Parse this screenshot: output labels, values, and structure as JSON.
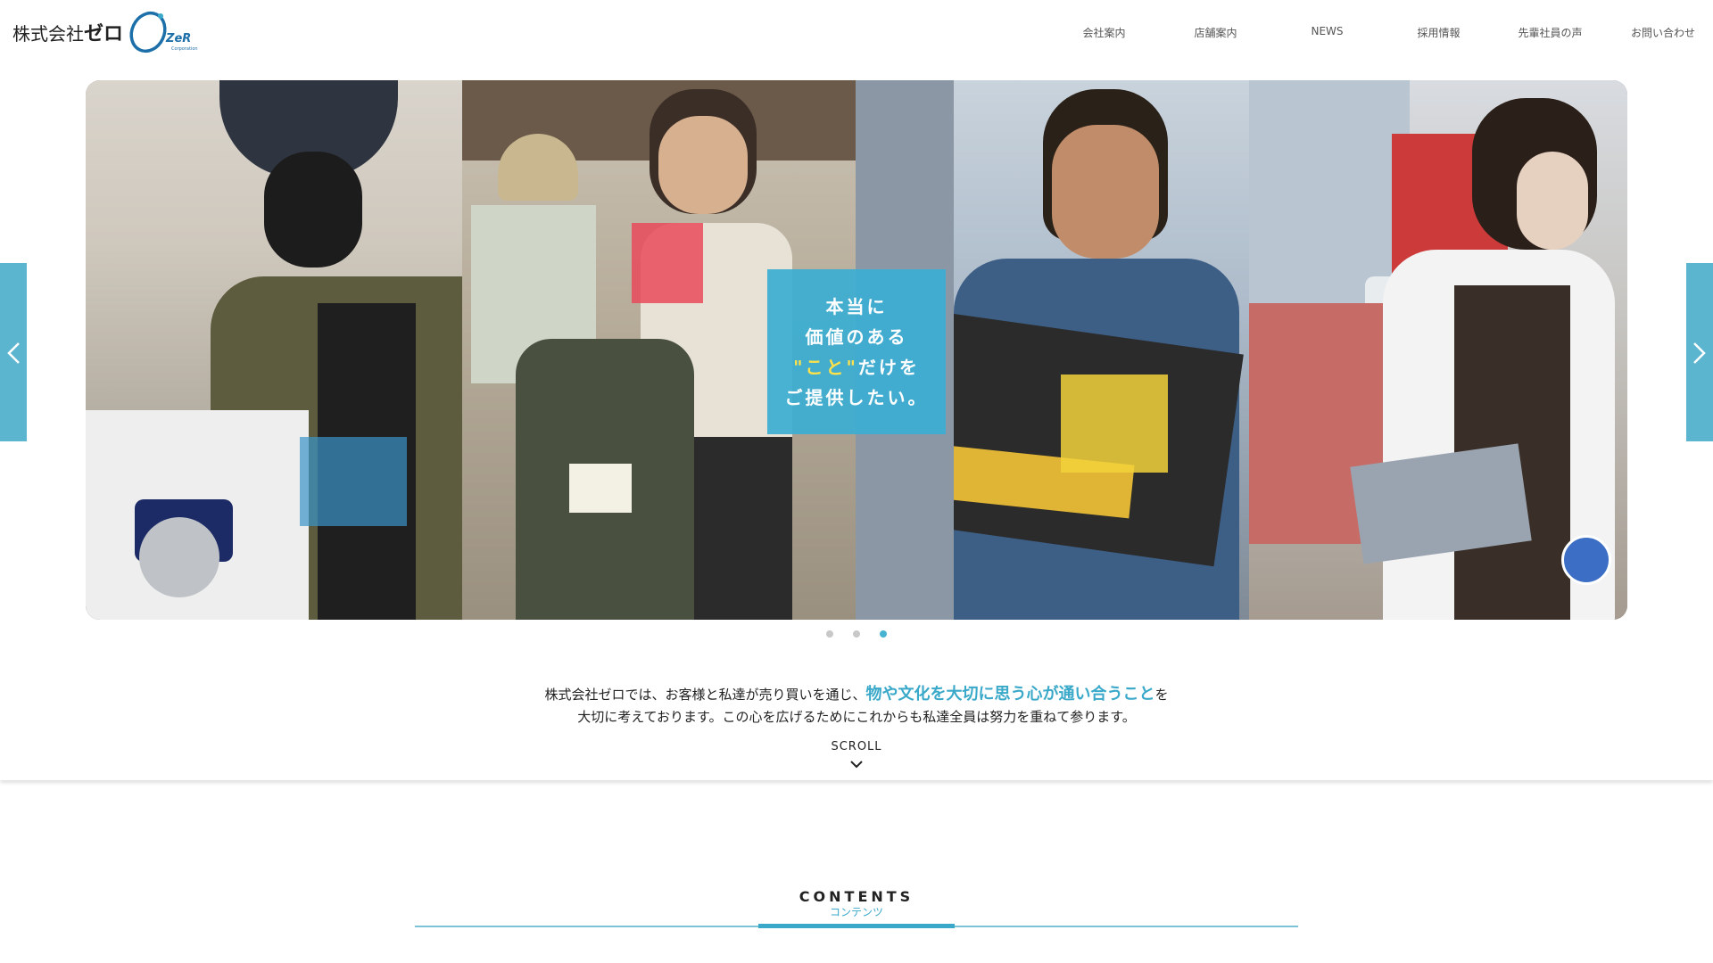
{
  "header": {
    "logo_text": "株式会社",
    "logo_zero": "ゼロ",
    "logo_mark": "ZeR",
    "logo_corp": "Corporation"
  },
  "nav": {
    "items": [
      "会社案内",
      "店舗案内",
      "NEWS",
      "採用情報",
      "先輩社員の声",
      "お問い合わせ"
    ]
  },
  "slider": {
    "caption_line1": "本当に",
    "caption_line2": "価値のある",
    "caption_hl": "\"こと\"",
    "caption_line3_rest": "だけを",
    "caption_line4": "ご提供したい。",
    "prev_icon": "chevron-left-icon",
    "next_icon": "chevron-right-icon",
    "dots_total": 3,
    "active_dot": 3
  },
  "intro": {
    "line1_a": "株式会社ゼロでは、お客様と私達が売り買いを通じ、",
    "line1_hl": "物や文化を大切に思う心が通い合うこと",
    "line1_b": "を",
    "line2": "大切に考えております。この心を広げるためにこれからも私達全員は努力を重ねて参ります。",
    "scroll": "SCROLL",
    "scroll_icon": "chevron-down-icon"
  },
  "contents": {
    "title": "CONTENTS",
    "subtitle": "コンテンツ"
  },
  "colors": {
    "accent": "#3aa9c9",
    "arrow_bg": "#5cb5cf",
    "highlight_yellow": "#ffe14a"
  }
}
